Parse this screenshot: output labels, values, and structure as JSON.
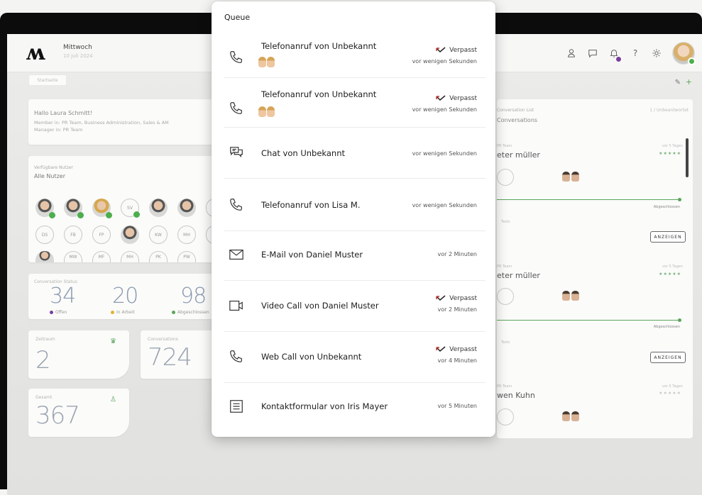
{
  "header": {
    "day": "Mittwoch",
    "date": "10 Juli 2024",
    "logo": "m"
  },
  "left": {
    "pill": "Startseite",
    "greeting_title": "Hallo Laura Schmitt!",
    "greeting_lines": [
      "Member in: PR Team, Business Administration, Sales & AM",
      "Manager in: PR Team"
    ],
    "users_label": "Verfügbare Nutzer",
    "users_title": "Alle Nutzer",
    "avatars_row2": [
      "DS",
      "FB",
      "FP",
      "",
      "KW",
      "MH"
    ],
    "avatars_row3": [
      "",
      "MW",
      "MF",
      "MH",
      "PK",
      "PW"
    ],
    "avatars_row1_initial": "SV",
    "conversations_label": "Conversation Status",
    "stats": [
      {
        "value": "34",
        "legend": "Offen",
        "color": "#7a3ea0"
      },
      {
        "value": "20",
        "legend": "In Arbeit",
        "color": "#e3b230"
      },
      {
        "value": "98",
        "legend": "Abgeschlossen",
        "color": "#5aa65a"
      }
    ],
    "box1_label": "Zeitraum",
    "box1_value": "2",
    "box2_label": "Conversations",
    "box2_value": "724",
    "box3_label": "Gesamt",
    "box3_value": "367"
  },
  "right": {
    "header_small": "Conversation List",
    "header_title": "Conversations",
    "header_right": "1 / Unbeantwortet",
    "entries": [
      {
        "team": "PR Team",
        "name": "eter müller",
        "days": "vor 5 Tagen",
        "status": "Abgeschlossen",
        "section": "Tests",
        "button": "ANZEIGEN"
      },
      {
        "team": "PR Team",
        "name": "eter müller",
        "days": "vor 5 Tagen",
        "status": "Abgeschlossen",
        "section": "Tests",
        "button": "ANZEIGEN"
      },
      {
        "team": "PR Team",
        "name": "wen Kuhn",
        "days": "vor 5 Tagen"
      }
    ]
  },
  "queue": {
    "title": "Queue",
    "items": [
      {
        "icon": "phone-icon",
        "label": "Telefonanruf von Unbekannt",
        "status": "Verpasst",
        "time": "vor wenigen Sekunden",
        "faces": true
      },
      {
        "icon": "phone-icon",
        "label": "Telefonanruf von Unbekannt",
        "status": "Verpasst",
        "time": "vor wenigen Sekunden",
        "faces": true
      },
      {
        "icon": "chat-icon",
        "label": "Chat von Unbekannt",
        "status": "",
        "time": "vor wenigen Sekunden"
      },
      {
        "icon": "phone-icon",
        "label": "Telefonanruf von Lisa M.",
        "status": "",
        "time": "vor wenigen Sekunden"
      },
      {
        "icon": "mail-icon",
        "label": "E-Mail von Daniel Muster",
        "status": "",
        "time": "vor 2 Minuten"
      },
      {
        "icon": "video-icon",
        "label": "Video Call von Daniel Muster",
        "status": "Verpasst",
        "time": "vor 2 Minuten"
      },
      {
        "icon": "phone-icon",
        "label": "Web Call von Unbekannt",
        "status": "Verpasst",
        "time": "vor 4 Minuten"
      },
      {
        "icon": "form-icon",
        "label": "Kontaktformular von Iris Mayer",
        "status": "",
        "time": "vor 5 Minuten"
      }
    ]
  },
  "colors": {
    "missed_red": "#c4342d",
    "online_green": "#4cae4c",
    "accent_purple": "#7a3ea0"
  }
}
